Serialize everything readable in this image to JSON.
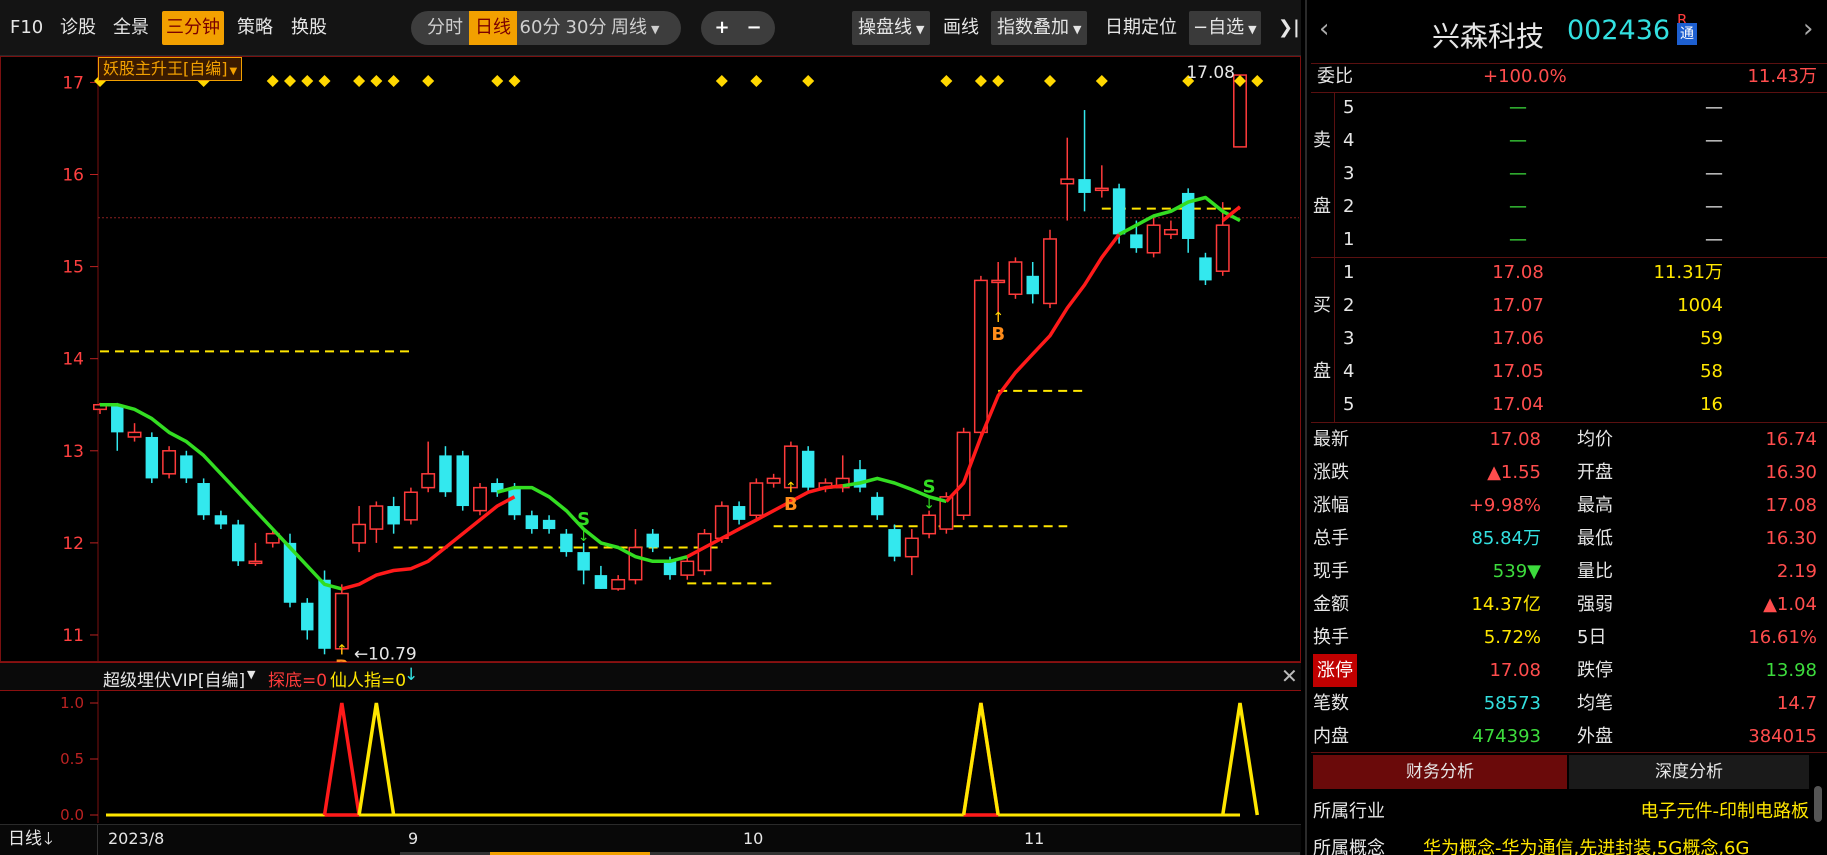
{
  "toolbar": {
    "f10": "F10",
    "diagnose": "诊股",
    "overview": "全景",
    "three_min": "三分钟",
    "strategy": "策略",
    "switch_stock": "换股",
    "periods": [
      "分时",
      "日线",
      "60分",
      "30分",
      "周线"
    ],
    "active_period": "日线",
    "zoom_in": "+",
    "zoom_out": "−",
    "trade_line": "操盘线",
    "draw_line": "画线",
    "index_overlay": "指数叠加",
    "date_locate": "日期定位",
    "watchlist": "自选"
  },
  "main_indicator": "妖股主升王[自编]",
  "sub_indicator": {
    "name": "超级埋伏VIP[自编]",
    "v1": "探底=0",
    "v2": "仙人指=0"
  },
  "period_selector": "日线",
  "x_labels": [
    "2023/8",
    "9",
    "10",
    "11"
  ],
  "chart_data": {
    "type": "candlestick",
    "y_ticks": [
      11,
      12,
      13,
      14,
      15,
      16,
      17
    ],
    "ylim": [
      10.75,
      17.2
    ],
    "max_label": "17.08",
    "min_label": "10.79",
    "candles": [
      [
        13.45,
        13.5,
        13.4,
        13.52
      ],
      [
        13.5,
        13.2,
        13.0,
        13.52
      ],
      [
        13.15,
        13.2,
        13.1,
        13.3
      ],
      [
        13.15,
        12.7,
        12.65,
        13.2
      ],
      [
        12.75,
        13.0,
        12.7,
        13.05
      ],
      [
        12.95,
        12.7,
        12.65,
        13.0
      ],
      [
        12.65,
        12.3,
        12.25,
        12.7
      ],
      [
        12.3,
        12.2,
        12.15,
        12.35
      ],
      [
        12.2,
        11.8,
        11.75,
        12.25
      ],
      [
        11.8,
        11.8,
        11.75,
        12.0
      ],
      [
        12.0,
        12.1,
        11.95,
        12.15
      ],
      [
        12.0,
        11.35,
        11.3,
        12.1
      ],
      [
        11.35,
        11.05,
        10.95,
        11.4
      ],
      [
        11.6,
        10.85,
        10.79,
        11.7
      ],
      [
        10.85,
        11.45,
        10.79,
        11.55
      ],
      [
        12.0,
        12.2,
        11.9,
        12.4
      ],
      [
        12.15,
        12.4,
        12.0,
        12.45
      ],
      [
        12.4,
        12.2,
        12.1,
        12.5
      ],
      [
        12.25,
        12.55,
        12.2,
        12.6
      ],
      [
        12.6,
        12.75,
        12.55,
        13.1
      ],
      [
        12.95,
        12.55,
        12.5,
        13.05
      ],
      [
        12.95,
        12.4,
        12.35,
        13.0
      ],
      [
        12.35,
        12.6,
        12.3,
        12.65
      ],
      [
        12.65,
        12.55,
        12.5,
        12.7
      ],
      [
        12.6,
        12.3,
        12.25,
        12.65
      ],
      [
        12.3,
        12.15,
        12.1,
        12.35
      ],
      [
        12.25,
        12.15,
        12.1,
        12.3
      ],
      [
        12.1,
        11.9,
        11.85,
        12.15
      ],
      [
        11.9,
        11.7,
        11.55,
        12.0
      ],
      [
        11.65,
        11.5,
        11.5,
        11.75
      ],
      [
        11.5,
        11.6,
        11.48,
        11.65
      ],
      [
        11.6,
        11.95,
        11.55,
        12.15
      ],
      [
        12.1,
        11.95,
        11.9,
        12.15
      ],
      [
        11.8,
        11.65,
        11.6,
        11.85
      ],
      [
        11.65,
        11.8,
        11.6,
        11.85
      ],
      [
        11.7,
        12.1,
        11.65,
        12.15
      ],
      [
        12.05,
        12.4,
        12.0,
        12.45
      ],
      [
        12.4,
        12.25,
        12.2,
        12.45
      ],
      [
        12.3,
        12.65,
        12.25,
        12.7
      ],
      [
        12.65,
        12.7,
        12.6,
        12.75
      ],
      [
        12.6,
        13.05,
        12.55,
        13.1
      ],
      [
        13.0,
        12.6,
        12.55,
        13.05
      ],
      [
        12.6,
        12.65,
        12.55,
        12.7
      ],
      [
        12.6,
        12.7,
        12.55,
        12.95
      ],
      [
        12.8,
        12.6,
        12.55,
        12.9
      ],
      [
        12.5,
        12.3,
        12.25,
        12.55
      ],
      [
        12.15,
        11.85,
        11.8,
        12.2
      ],
      [
        11.85,
        12.05,
        11.65,
        12.15
      ],
      [
        12.1,
        12.3,
        12.05,
        12.35
      ],
      [
        12.15,
        12.5,
        12.1,
        12.55
      ],
      [
        12.3,
        13.2,
        12.25,
        13.25
      ],
      [
        13.2,
        14.85,
        13.15,
        14.9
      ],
      [
        14.85,
        14.85,
        14.4,
        15.05
      ],
      [
        14.7,
        15.05,
        14.65,
        15.1
      ],
      [
        14.9,
        14.7,
        14.6,
        15.05
      ],
      [
        14.6,
        15.3,
        14.55,
        15.4
      ],
      [
        15.9,
        15.95,
        15.5,
        16.4
      ],
      [
        15.95,
        15.8,
        15.6,
        16.7
      ],
      [
        15.85,
        15.85,
        15.75,
        16.1
      ],
      [
        15.85,
        15.35,
        15.25,
        15.9
      ],
      [
        15.35,
        15.2,
        15.15,
        15.5
      ],
      [
        15.15,
        15.45,
        15.1,
        15.55
      ],
      [
        15.35,
        15.4,
        15.3,
        15.5
      ],
      [
        15.8,
        15.3,
        15.15,
        15.85
      ],
      [
        15.1,
        14.85,
        14.8,
        15.15
      ],
      [
        14.95,
        15.45,
        14.9,
        15.7
      ],
      [
        16.3,
        17.08,
        16.3,
        17.08
      ]
    ],
    "ma_up": [
      null,
      null,
      null,
      null,
      null,
      null,
      null,
      null,
      null,
      null,
      null,
      null,
      null,
      null,
      11.5,
      11.55,
      11.65,
      11.7,
      11.72,
      11.8,
      11.95,
      12.1,
      12.25,
      12.4,
      12.5,
      null,
      null,
      null,
      null,
      null,
      null,
      null,
      null,
      null,
      11.85,
      11.95,
      12.05,
      12.15,
      12.25,
      12.35,
      12.45,
      12.55,
      12.6,
      12.62,
      null,
      null,
      null,
      null,
      null,
      12.45,
      12.65,
      13.15,
      13.6,
      13.85,
      14.05,
      14.25,
      14.55,
      14.8,
      15.1,
      15.35,
      null,
      null,
      null,
      null,
      null,
      15.5,
      15.65
    ],
    "ma_down": [
      13.5,
      13.5,
      13.45,
      13.35,
      13.2,
      13.1,
      12.95,
      12.75,
      12.55,
      12.35,
      12.15,
      11.95,
      11.75,
      11.55,
      11.5,
      null,
      null,
      null,
      null,
      null,
      null,
      null,
      null,
      12.55,
      12.6,
      12.6,
      12.5,
      12.35,
      12.15,
      12.0,
      11.95,
      11.85,
      11.8,
      11.8,
      11.85,
      null,
      null,
      null,
      null,
      null,
      null,
      null,
      12.6,
      12.62,
      12.65,
      12.7,
      12.65,
      12.58,
      12.5,
      12.45,
      null,
      null,
      null,
      null,
      null,
      null,
      null,
      null,
      null,
      15.35,
      15.45,
      15.55,
      15.6,
      15.7,
      15.75,
      15.6,
      15.5
    ],
    "dashed_levels": [
      [
        0,
        18,
        14.08
      ],
      [
        17,
        36,
        11.95
      ],
      [
        34,
        39,
        11.56
      ],
      [
        39,
        56,
        12.18
      ],
      [
        52,
        57,
        13.65
      ],
      [
        58,
        66,
        15.63
      ]
    ],
    "ref_line": 15.53,
    "buy_signals": [
      14,
      40,
      52
    ],
    "sell_signals": [
      28,
      48
    ],
    "diamond_indices": [
      0,
      6,
      10,
      11,
      12,
      13,
      15,
      16,
      17,
      19,
      23,
      24,
      36,
      38,
      41,
      49,
      51,
      52,
      55,
      58,
      63,
      66,
      67
    ],
    "sub_y_ticks": [
      0.0,
      0.5,
      1.0
    ],
    "sub_red_peaks": [
      14,
      51
    ],
    "sub_yellow_peaks": [
      16,
      51,
      66
    ]
  },
  "quote": {
    "name": "兴森科技",
    "code": "002436",
    "badge_r": "R",
    "badge_tong": "通",
    "weibi_label": "委比",
    "weibi_value": "+100.0%",
    "weibi_vol": "11.43万",
    "sell_label_chars": [
      "卖",
      "盘"
    ],
    "buy_label_chars": [
      "买",
      "盘"
    ],
    "sell_levels": [
      {
        "n": "5",
        "p": "—",
        "v": "—"
      },
      {
        "n": "4",
        "p": "—",
        "v": "—"
      },
      {
        "n": "3",
        "p": "—",
        "v": "—"
      },
      {
        "n": "2",
        "p": "—",
        "v": "—"
      },
      {
        "n": "1",
        "p": "—",
        "v": "—"
      }
    ],
    "buy_levels": [
      {
        "n": "1",
        "p": "17.08",
        "v": "11.31万"
      },
      {
        "n": "2",
        "p": "17.07",
        "v": "1004"
      },
      {
        "n": "3",
        "p": "17.06",
        "v": "59"
      },
      {
        "n": "4",
        "p": "17.05",
        "v": "58"
      },
      {
        "n": "5",
        "p": "17.04",
        "v": "16"
      }
    ],
    "stats": [
      {
        "l1": "最新",
        "v1": "17.08",
        "c1": "red",
        "l2": "均价",
        "v2": "16.74",
        "c2": "red"
      },
      {
        "l1": "涨跌",
        "v1": "▲1.55",
        "c1": "red",
        "l2": "开盘",
        "v2": "16.30",
        "c2": "red"
      },
      {
        "l1": "涨幅",
        "v1": "+9.98%",
        "c1": "red",
        "l2": "最高",
        "v2": "17.08",
        "c2": "red"
      },
      {
        "l1": "总手",
        "v1": "85.84万",
        "c1": "cyn",
        "l2": "最低",
        "v2": "16.30",
        "c2": "red"
      },
      {
        "l1": "现手",
        "v1": "539▼",
        "c1": "grn",
        "l2": "量比",
        "v2": "2.19",
        "c2": "red"
      },
      {
        "l1": "金额",
        "v1": "14.37亿",
        "c1": "yel",
        "l2": "强弱",
        "v2": "▲1.04",
        "c2": "red"
      },
      {
        "l1": "换手",
        "v1": "5.72%",
        "c1": "yel",
        "l2": "5日",
        "v2": "16.61%",
        "c2": "red"
      },
      {
        "l1": "涨停",
        "v1": "17.08",
        "c1": "red",
        "l2": "跌停",
        "v2": "13.98",
        "c2": "grn"
      },
      {
        "l1": "笔数",
        "v1": "58573",
        "c1": "cyn",
        "l2": "均笔",
        "v2": "14.7",
        "c2": "red"
      },
      {
        "l1": "内盘",
        "v1": "474393",
        "c1": "grn",
        "l2": "外盘",
        "v2": "384015",
        "c2": "red"
      }
    ],
    "tabs": [
      "财务分析",
      "深度分析"
    ],
    "industry_label": "所属行业",
    "industry_value": "电子元件-印制电路板",
    "concept_label": "所属概念",
    "concept_value": "华为概念-华为通信,先进封装,5G概念,6G"
  },
  "colors": {
    "up": "#ff3b3b",
    "down": "#33e8ee",
    "ma_up": "#ff1a1a",
    "ma_down": "#33dd22",
    "accent": "#f2a000",
    "signal": "#ffd700"
  }
}
